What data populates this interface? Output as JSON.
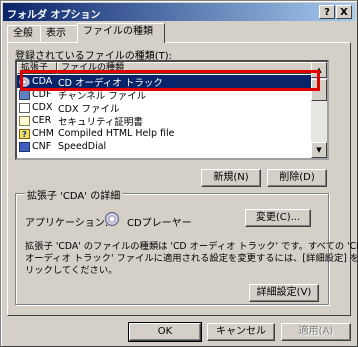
{
  "window": {
    "title": "フォルダ オプション",
    "help_btn": "?",
    "close_btn": "X"
  },
  "tabs": [
    "全般",
    "表示",
    "ファイルの種類"
  ],
  "registered_label": "登録されているファイルの種類(T):",
  "list": {
    "columns": [
      "拡張子",
      "ファイルの種類"
    ],
    "rows": [
      {
        "ext": "CDA",
        "name": "CD オーディオ トラック",
        "icon": "cd-icon"
      },
      {
        "ext": "CDF",
        "name": "チャンネル ファイル",
        "icon": "channel-file-icon"
      },
      {
        "ext": "CDX",
        "name": "CDX ファイル",
        "icon": "file-icon"
      },
      {
        "ext": "CER",
        "name": "セキュリティ証明書",
        "icon": "certificate-icon"
      },
      {
        "ext": "CHM",
        "name": "Compiled HTML Help file",
        "icon": "help-file-icon"
      },
      {
        "ext": "CNF",
        "name": "SpeedDial",
        "icon": "speeddial-icon"
      }
    ]
  },
  "buttons": {
    "new": "新規(N)",
    "delete": "削除(D)",
    "change": "変更(C)...",
    "advanced": "詳細設定(V)",
    "ok": "OK",
    "cancel": "キャンセル",
    "apply": "適用(A)"
  },
  "details": {
    "title": "拡張子 'CDA' の詳細",
    "app_label": "アプリケーション:",
    "app_name": "CDプレーヤー",
    "desc1": "拡張子 'CDA' のファイルの種類は 'CD オーディオ トラック' です。すべての 'CD",
    "desc2": "オーディオ トラック' ファイルに適用される設定を変更するには、[詳細設定] をク",
    "desc3": "リックしてください。"
  },
  "colors": {
    "selection": "#0a246a",
    "highlight_box": "#e00000",
    "face": "#d4d0c8"
  }
}
